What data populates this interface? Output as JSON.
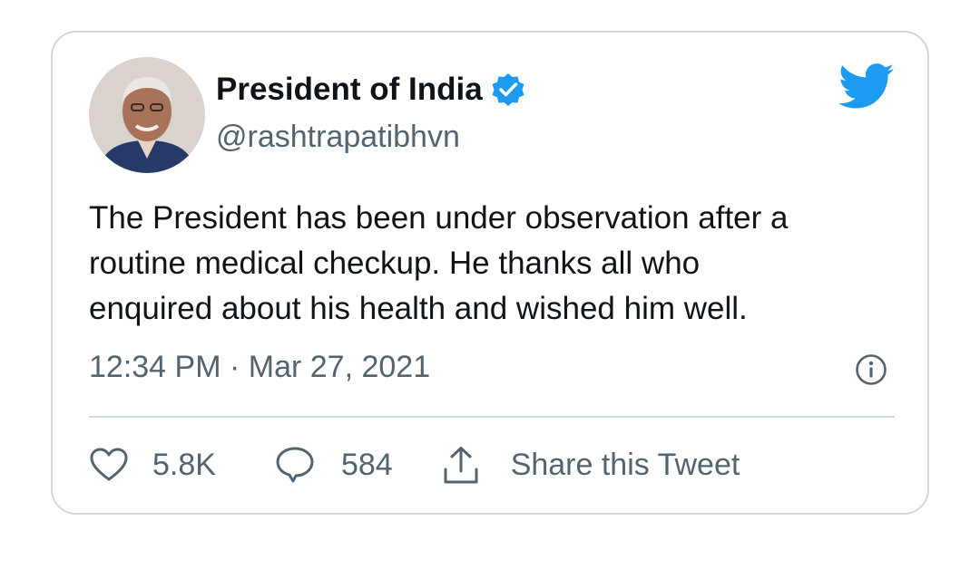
{
  "tweet": {
    "display_name": "President of India",
    "handle": "@rashtrapatibhvn",
    "verified": true,
    "text_lines": [
      "The President has been under observation after a",
      "routine medical checkup. He thanks all who",
      "enquired about his health and wished him well."
    ],
    "time": "12:34 PM",
    "date": "Mar 27, 2021",
    "meta_separator": "·"
  },
  "actions": {
    "likes": "5.8K",
    "replies": "584",
    "share_label": "Share this Tweet"
  },
  "icons": {
    "avatar": "profile-photo",
    "verified": "verified-badge-icon",
    "brand": "twitter-bird-icon",
    "info": "info-icon",
    "like": "heart-icon",
    "reply": "reply-bubble-icon",
    "share": "share-icon"
  },
  "colors": {
    "brand_blue": "#1d9bf0",
    "text": "#0f1419",
    "secondary": "#536471",
    "border": "#cfd9de"
  }
}
